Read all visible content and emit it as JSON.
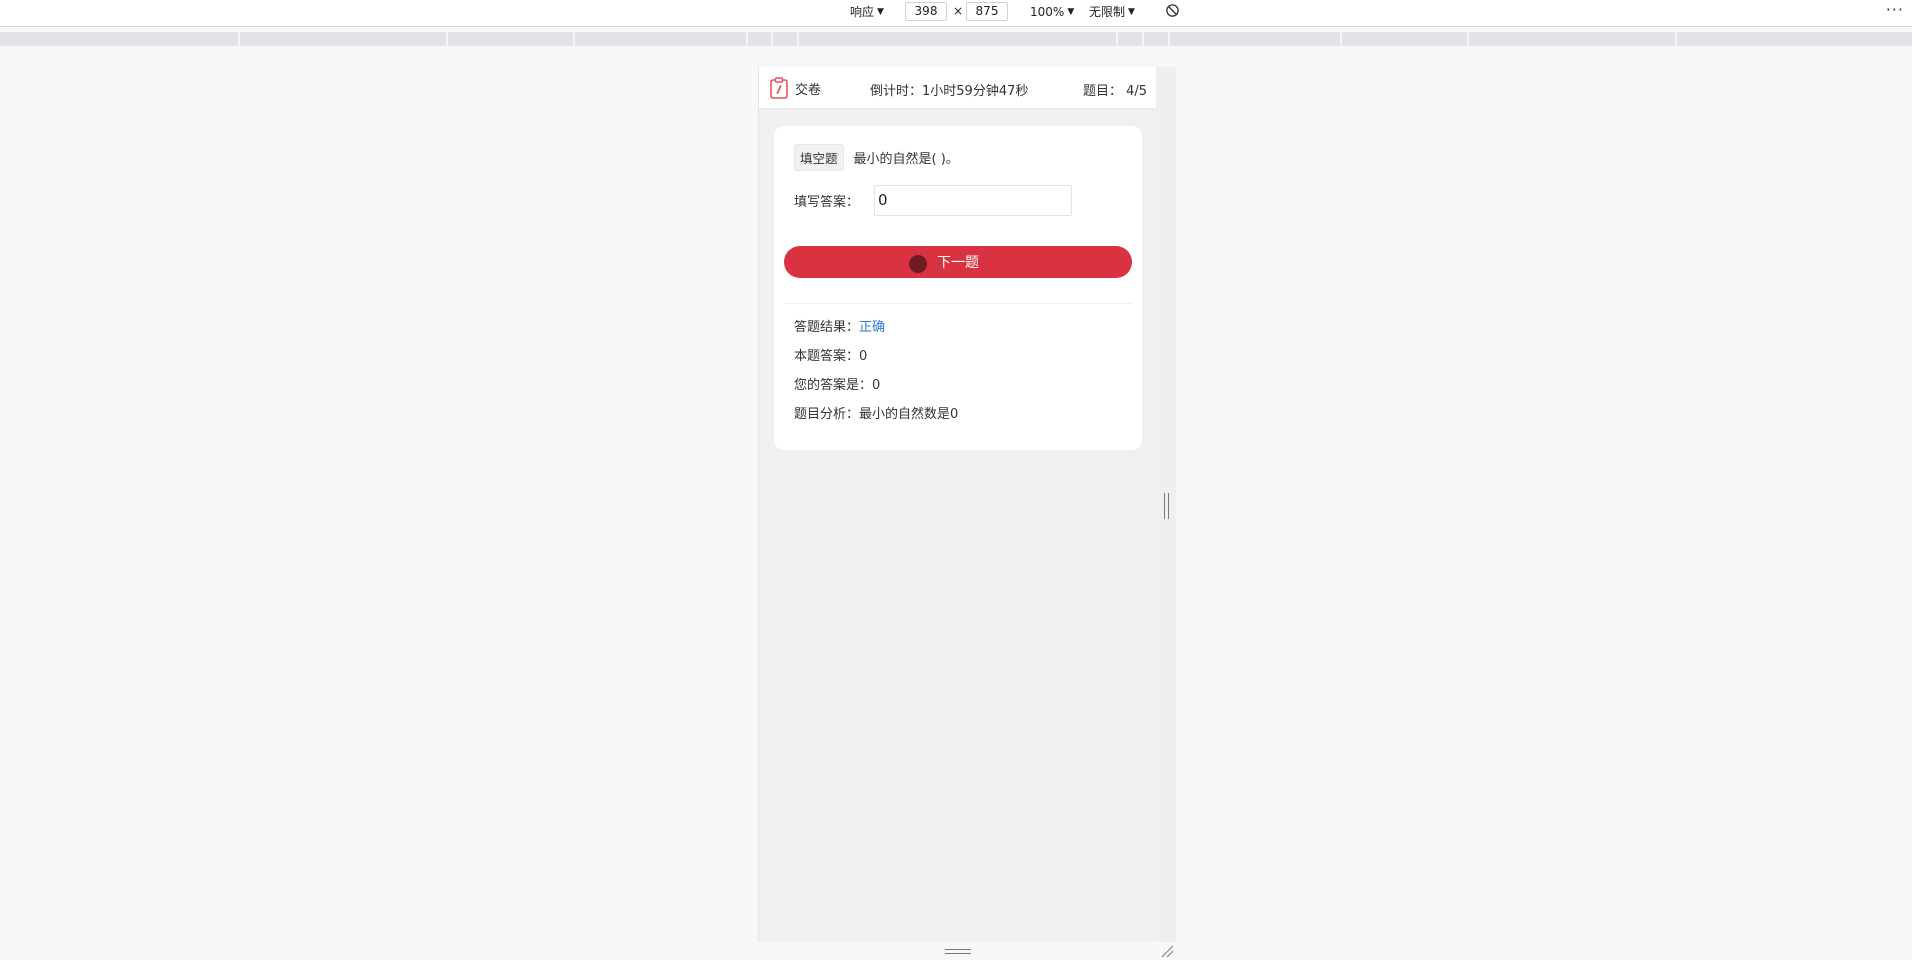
{
  "devtools": {
    "device_mode": "响应",
    "width": "398",
    "height": "875",
    "times": "×",
    "zoom": "100%",
    "throttle": "无限制",
    "more": "···"
  },
  "header": {
    "submit_label": "交卷",
    "timer": "倒计时：1小时59分钟47秒",
    "progress": "题目：  4/5"
  },
  "question": {
    "type_tag": "填空题",
    "text": "最小的自然是(  )。",
    "answer_label": "填写答案：",
    "answer_value": "0",
    "next_label": "下一题"
  },
  "result": {
    "result_label": "答题结果：",
    "result_value": "正确",
    "correct_answer_label": "本题答案：",
    "correct_answer_value": "0",
    "your_answer_label": "您的答案是：",
    "your_answer_value": "0",
    "analysis_label": "题目分析：",
    "analysis_value": "最小的自然数是0"
  },
  "colors": {
    "primary_button": "#d93240",
    "correct_text": "#2d7bd6",
    "submit_icon": "#e05262"
  }
}
